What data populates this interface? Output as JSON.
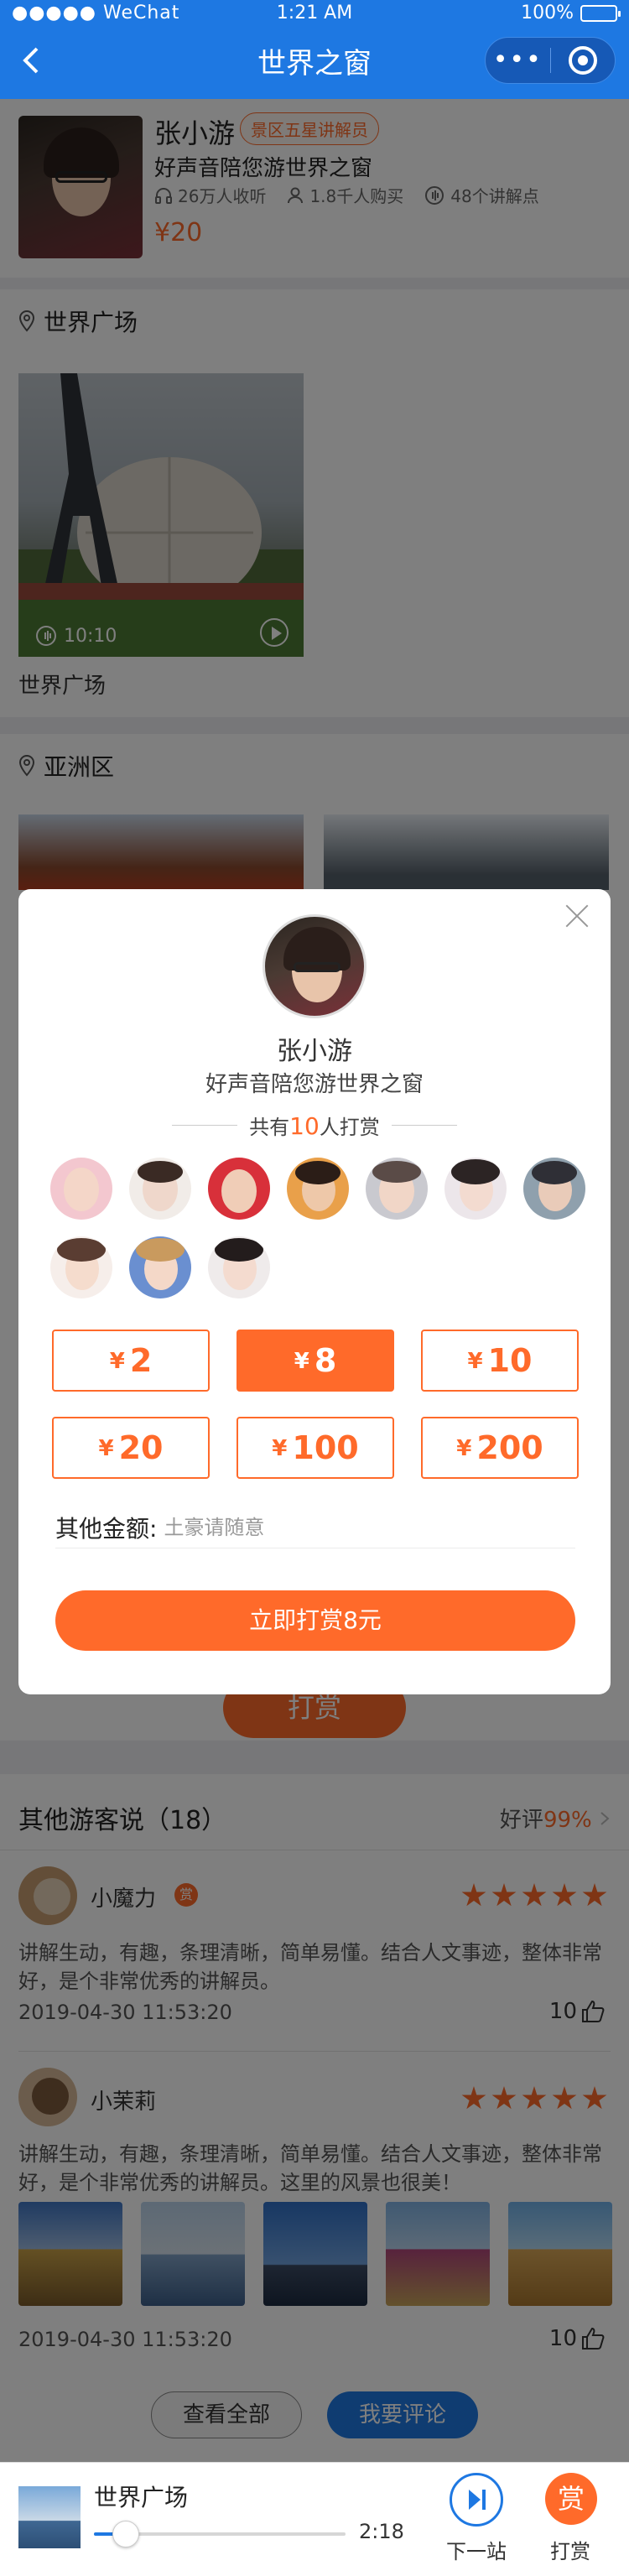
{
  "status": {
    "carrier": "●●●●● WeChat",
    "time": "1:21 AM",
    "battery": "100%"
  },
  "nav": {
    "title": "世界之窗",
    "more_icon": "•••"
  },
  "guide": {
    "name": "张小游",
    "tag": "景区五星讲解员",
    "slogan": "好声音陪您游世界之窗",
    "listeners": "26万人收听",
    "buyers": "1.8千人购买",
    "points": "48个讲解点",
    "price": "¥20"
  },
  "sections": [
    {
      "title": "世界广场",
      "duration": "10:10",
      "card_title": "世界广场"
    },
    {
      "title": "亚洲区"
    }
  ],
  "reward_button": "打赏",
  "comments": {
    "title": "其他游客说（18）",
    "rating_label": "好评",
    "rating_value": "99%",
    "items": [
      {
        "name": "小魔力",
        "badge": "赏",
        "text": "讲解生动，有趣，条理清晰，简单易懂。结合人文事迹，整体非常好，是个非常优秀的讲解员。",
        "date": "2019-04-30  11:53:20",
        "likes": "10"
      },
      {
        "name": "小茉莉",
        "text": "讲解生动，有趣，条理清晰，简单易懂。结合人文事迹，整体非常好，是个非常优秀的讲解员。这里的风景也很美！",
        "date": "2019-04-30  11:53:20",
        "likes": "10"
      }
    ],
    "view_all": "查看全部",
    "write": "我要评论"
  },
  "player": {
    "title": "世界广场",
    "time": "2:18",
    "progress": 0.09,
    "next_label": "下一站",
    "tip_label": "打赏",
    "tip_icon": "赏"
  },
  "modal": {
    "name": "张小游",
    "slogan": "好声音陪您游世界之窗",
    "count_prefix": "共有",
    "count": "10",
    "count_suffix": "人打赏",
    "amounts": [
      "2",
      "8",
      "10",
      "20",
      "100",
      "200"
    ],
    "currency": "¥",
    "selected": "8",
    "other_label": "其他金额:",
    "other_placeholder": "土豪请随意",
    "confirm": "立即打赏8元"
  },
  "colors": {
    "primary": "#1e78e2",
    "accent": "#ff6a2a"
  }
}
